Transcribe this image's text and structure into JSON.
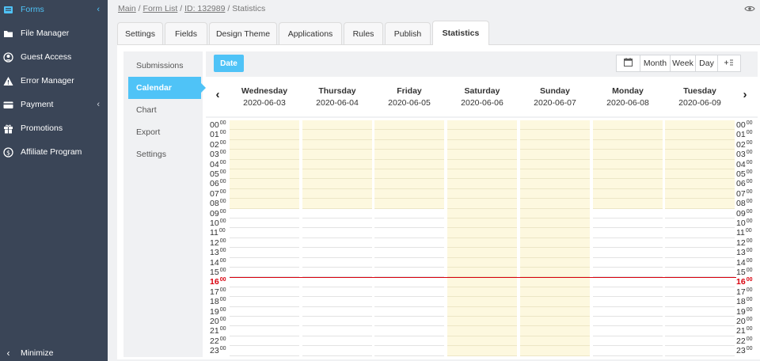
{
  "sidebar": {
    "items": [
      {
        "label": "Forms",
        "icon": "forms-icon",
        "active": true,
        "chevron": "‹"
      },
      {
        "label": "File Manager",
        "icon": "folder-icon"
      },
      {
        "label": "Guest Access",
        "icon": "user-circle-icon"
      },
      {
        "label": "Error Manager",
        "icon": "warning-icon"
      },
      {
        "label": "Payment",
        "icon": "wallet-icon",
        "chevron": "‹"
      },
      {
        "label": "Promotions",
        "icon": "gift-icon"
      },
      {
        "label": "Affiliate Program",
        "icon": "dollar-circle-icon"
      }
    ],
    "minimize": {
      "label": "Minimize",
      "icon": "chevron-left-icon"
    }
  },
  "breadcrumb": {
    "main": "Main",
    "form_list": "Form List",
    "id": "ID: 132989",
    "current": "Statistics",
    "sep": " / "
  },
  "tabs": [
    "Settings",
    "Fields",
    "Design Theme",
    "Applications",
    "Rules",
    "Publish",
    "Statistics"
  ],
  "active_tab": "Statistics",
  "subnav": {
    "items": [
      "Submissions",
      "Calendar",
      "Chart",
      "Export",
      "Settings"
    ],
    "active": "Calendar"
  },
  "calendar": {
    "date_button": "Date",
    "views": [
      "Month",
      "Week",
      "Day"
    ],
    "prev": "‹",
    "next": "›",
    "days": [
      {
        "name": "Wednesday",
        "date": "2020-06-03"
      },
      {
        "name": "Thursday",
        "date": "2020-06-04"
      },
      {
        "name": "Friday",
        "date": "2020-06-05"
      },
      {
        "name": "Saturday",
        "date": "2020-06-06"
      },
      {
        "name": "Sunday",
        "date": "2020-06-07"
      },
      {
        "name": "Monday",
        "date": "2020-06-08"
      },
      {
        "name": "Tuesday",
        "date": "2020-06-09"
      }
    ],
    "hours": [
      "00",
      "01",
      "02",
      "03",
      "04",
      "05",
      "06",
      "07",
      "08",
      "09",
      "10",
      "11",
      "12",
      "13",
      "14",
      "15",
      "16",
      "17",
      "18",
      "19",
      "20",
      "21",
      "22",
      "23"
    ],
    "minutes_label": "00",
    "current_hour": "16",
    "colors": {
      "accent": "#4fc3f7",
      "highlight": "#fdf8df",
      "now": "#d9000d",
      "sidebar": "#3a4557"
    }
  }
}
